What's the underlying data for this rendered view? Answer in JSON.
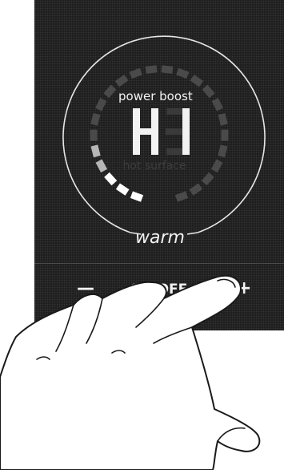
{
  "display": {
    "mode_label": "power boost",
    "segment_readout": "H1",
    "hot_surface_label": "hot surface",
    "preset_label": "warm"
  },
  "controls": {
    "minus_label": "—",
    "onoff_label": "ON/OFF",
    "plus_label": "+"
  },
  "level_ring": {
    "segments_total": 24,
    "lit_segments": 5
  },
  "colors": {
    "panel": "#1f1f1f",
    "text": "#f2f2f2",
    "segment_dim": "#4a4a4a",
    "segment_lit": "#ffffff",
    "segment_mid": "#b5b5b5"
  }
}
